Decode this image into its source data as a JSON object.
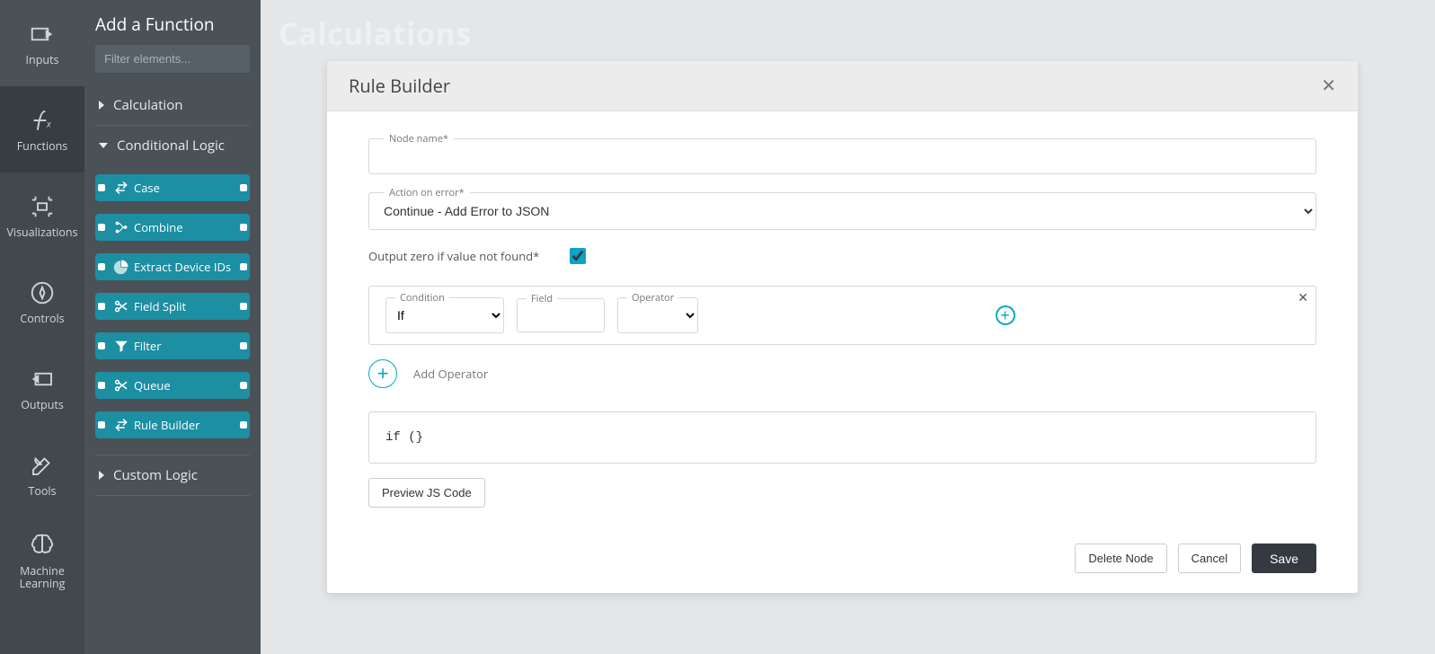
{
  "nav": {
    "items": [
      {
        "label": "Inputs"
      },
      {
        "label": "Functions"
      },
      {
        "label": "Visualizations"
      },
      {
        "label": "Controls"
      },
      {
        "label": "Outputs"
      },
      {
        "label": "Tools"
      },
      {
        "label": "Machine\nLearning"
      }
    ]
  },
  "sidebar": {
    "title": "Add a Function",
    "filterPlaceholder": "Filter elements...",
    "sections": {
      "calculation": {
        "label": "Calculation"
      },
      "conditional": {
        "label": "Conditional Logic"
      },
      "custom": {
        "label": "Custom Logic"
      }
    },
    "functions": [
      {
        "label": "Case",
        "icon": "swap"
      },
      {
        "label": "Combine",
        "icon": "merge"
      },
      {
        "label": "Extract Device IDs",
        "icon": "pie"
      },
      {
        "label": "Field Split",
        "icon": "scissors"
      },
      {
        "label": "Filter",
        "icon": "funnel"
      },
      {
        "label": "Queue",
        "icon": "scissors"
      },
      {
        "label": "Rule Builder",
        "icon": "swap"
      }
    ]
  },
  "page": {
    "title": "Calculations"
  },
  "modal": {
    "title": "Rule Builder",
    "nodeNameLabel": "Node name*",
    "nodeNameValue": "",
    "actionOnErrorLabel": "Action on error*",
    "actionOnErrorValue": "Continue - Add Error to JSON",
    "outputZeroLabel": "Output zero if value not found*",
    "outputZeroChecked": true,
    "rule": {
      "conditionLabel": "Condition",
      "conditionValue": "If",
      "fieldLabel": "Field",
      "fieldValue": "",
      "operatorLabel": "Operator",
      "operatorValue": ""
    },
    "addOperatorLabel": "Add Operator",
    "codePreview": "if (}",
    "previewBtn": "Preview JS Code",
    "deleteBtn": "Delete Node",
    "cancelBtn": "Cancel",
    "saveBtn": "Save"
  }
}
